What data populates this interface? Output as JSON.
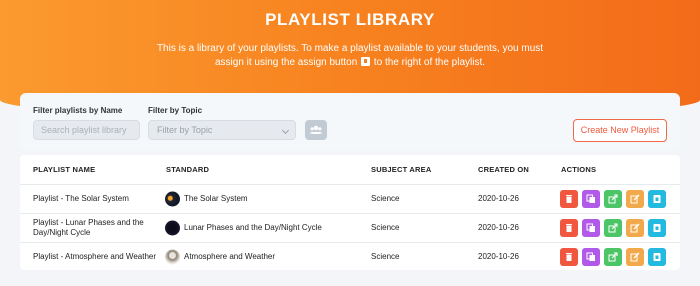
{
  "header": {
    "title": "PLAYLIST LIBRARY",
    "description_part1": "This is a library of your playlists. To make a playlist available to your students, you must assign it using the assign button",
    "description_part2": "to the right of the playlist."
  },
  "filters": {
    "name_label": "Filter playlists by Name",
    "name_placeholder": "Search playlist library",
    "topic_label": "Filter by Topic",
    "topic_selected": "Filter by Topic",
    "create_label": "Create New Playlist"
  },
  "table": {
    "columns": [
      "PLAYLIST NAME",
      "STANDARD",
      "SUBJECT AREA",
      "CREATED ON",
      "ACTIONS"
    ],
    "rows": [
      {
        "name": "Playlist - The Solar System",
        "standard": "The Solar System",
        "subject": "Science",
        "created": "2020-10-26"
      },
      {
        "name": "Playlist - Lunar Phases and the Day/Night Cycle",
        "standard": "Lunar Phases and the Day/Night Cycle",
        "subject": "Science",
        "created": "2020-10-26"
      },
      {
        "name": "Playlist - Atmosphere and Weather",
        "standard": "Atmosphere and Weather",
        "subject": "Science",
        "created": "2020-10-26"
      }
    ]
  },
  "icons": {
    "delete": "trash-icon",
    "copy": "copy-icon",
    "share": "share-icon",
    "edit": "edit-icon",
    "assign": "assign-icon",
    "group": "users-icon"
  },
  "colors": {
    "header_start": "#fb9a2f",
    "header_end": "#f36b1a",
    "create_button": "#ef5a3c",
    "delete": "#f0573e",
    "copy": "#b15ae9",
    "share": "#4cc567",
    "edit": "#f2a94b",
    "assign": "#24b9df"
  }
}
